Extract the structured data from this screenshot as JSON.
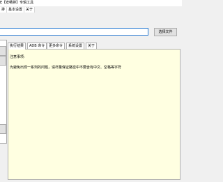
{
  "window": {
    "title": "E【安畅排】专辑工具"
  },
  "menubar": {
    "items": [
      {
        "label": "排"
      },
      {
        "label": "基本设置"
      },
      {
        "label": "关于"
      }
    ]
  },
  "path_bar": {
    "value": "",
    "browse_label": "选择文件"
  },
  "tabs": [
    {
      "label": "执行结果",
      "active": true
    },
    {
      "label": "ADB 命令",
      "active": false
    },
    {
      "label": "更多命令",
      "active": false
    },
    {
      "label": "系统设置",
      "active": false
    },
    {
      "label": "关于",
      "active": false
    }
  ],
  "output": {
    "lines": [
      "注意事项:",
      "为避免出现一系列的问题，请尽量保证路径中不要含有中文、空格等字符"
    ]
  }
}
